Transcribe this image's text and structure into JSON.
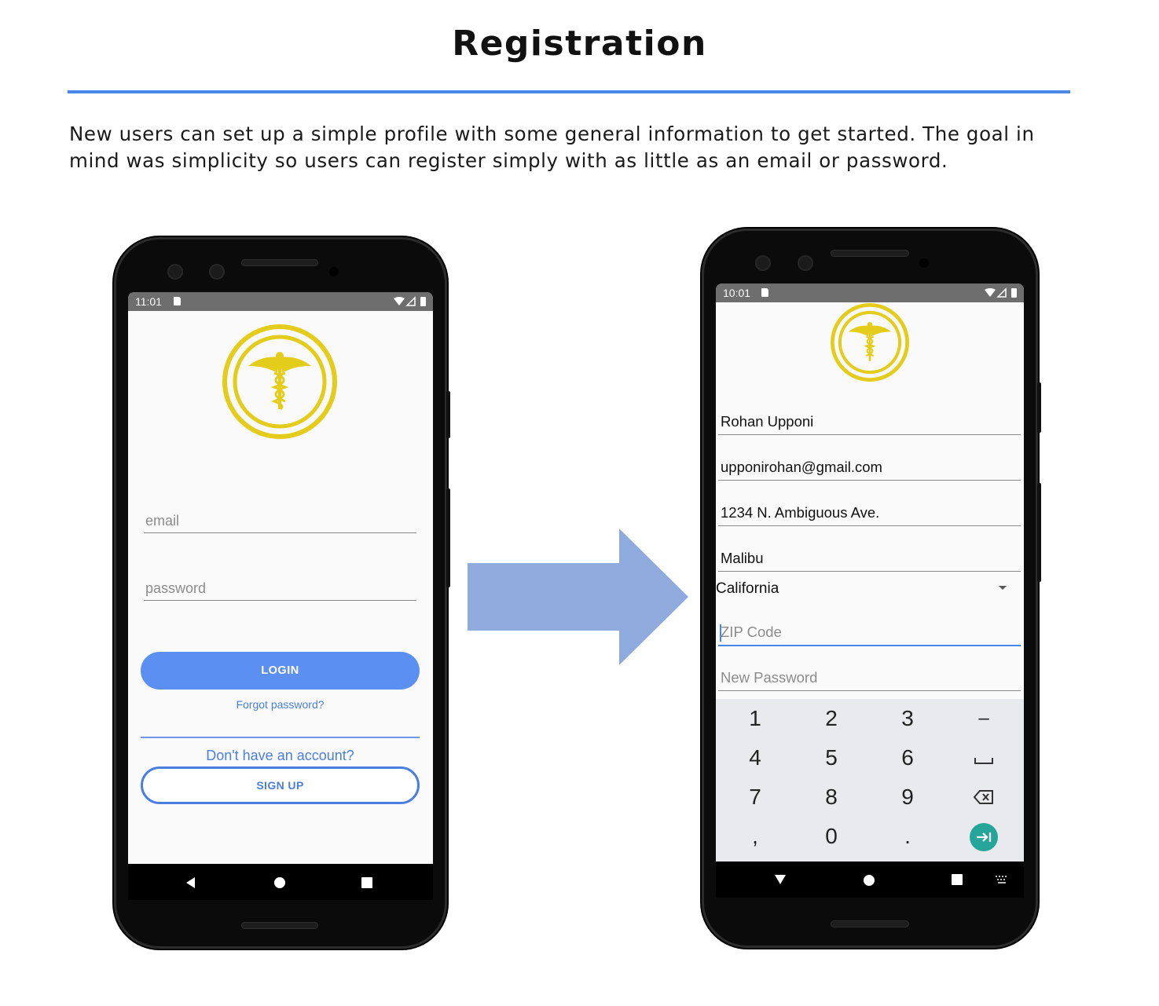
{
  "page": {
    "title": "Registration",
    "intro": "New users can set up a simple profile with some general information to get started. The goal in mind was simplicity so users can register simply with as little as an email or password."
  },
  "colors": {
    "accent_rule": "#4a86e8",
    "arrow": "#8faadc",
    "logo_gold": "#e4cc1a",
    "login_button": "#5b8ff2",
    "link_blue": "#4a7ee0",
    "enter_key": "#26a69a"
  },
  "login_phone": {
    "status_time": "11:01",
    "email_placeholder": "email",
    "password_placeholder": "password",
    "login_label": "LOGIN",
    "forgot_label": "Forgot password?",
    "no_account_label": "Don't have an account?",
    "signup_label": "SIGN UP",
    "nav": [
      "back-icon",
      "home-icon",
      "recents-icon"
    ]
  },
  "register_phone": {
    "status_time": "10:01",
    "fields": {
      "name": "Rohan Upponi",
      "email": "upponirohan@gmail.com",
      "address": "1234 N. Ambiguous Ave.",
      "city": "Malibu",
      "state": "California",
      "zip_placeholder": "ZIP Code",
      "password_placeholder": "New Password"
    },
    "keypad": {
      "row1": [
        "1",
        "2",
        "3",
        "–"
      ],
      "row2": [
        "4",
        "5",
        "6",
        "␣"
      ],
      "row3": [
        "7",
        "8",
        "9"
      ],
      "row4": [
        ",",
        "0",
        "."
      ]
    },
    "nav": [
      "hide-keyboard-icon",
      "home-icon",
      "recents-icon",
      "keyboard-switch-icon"
    ]
  }
}
